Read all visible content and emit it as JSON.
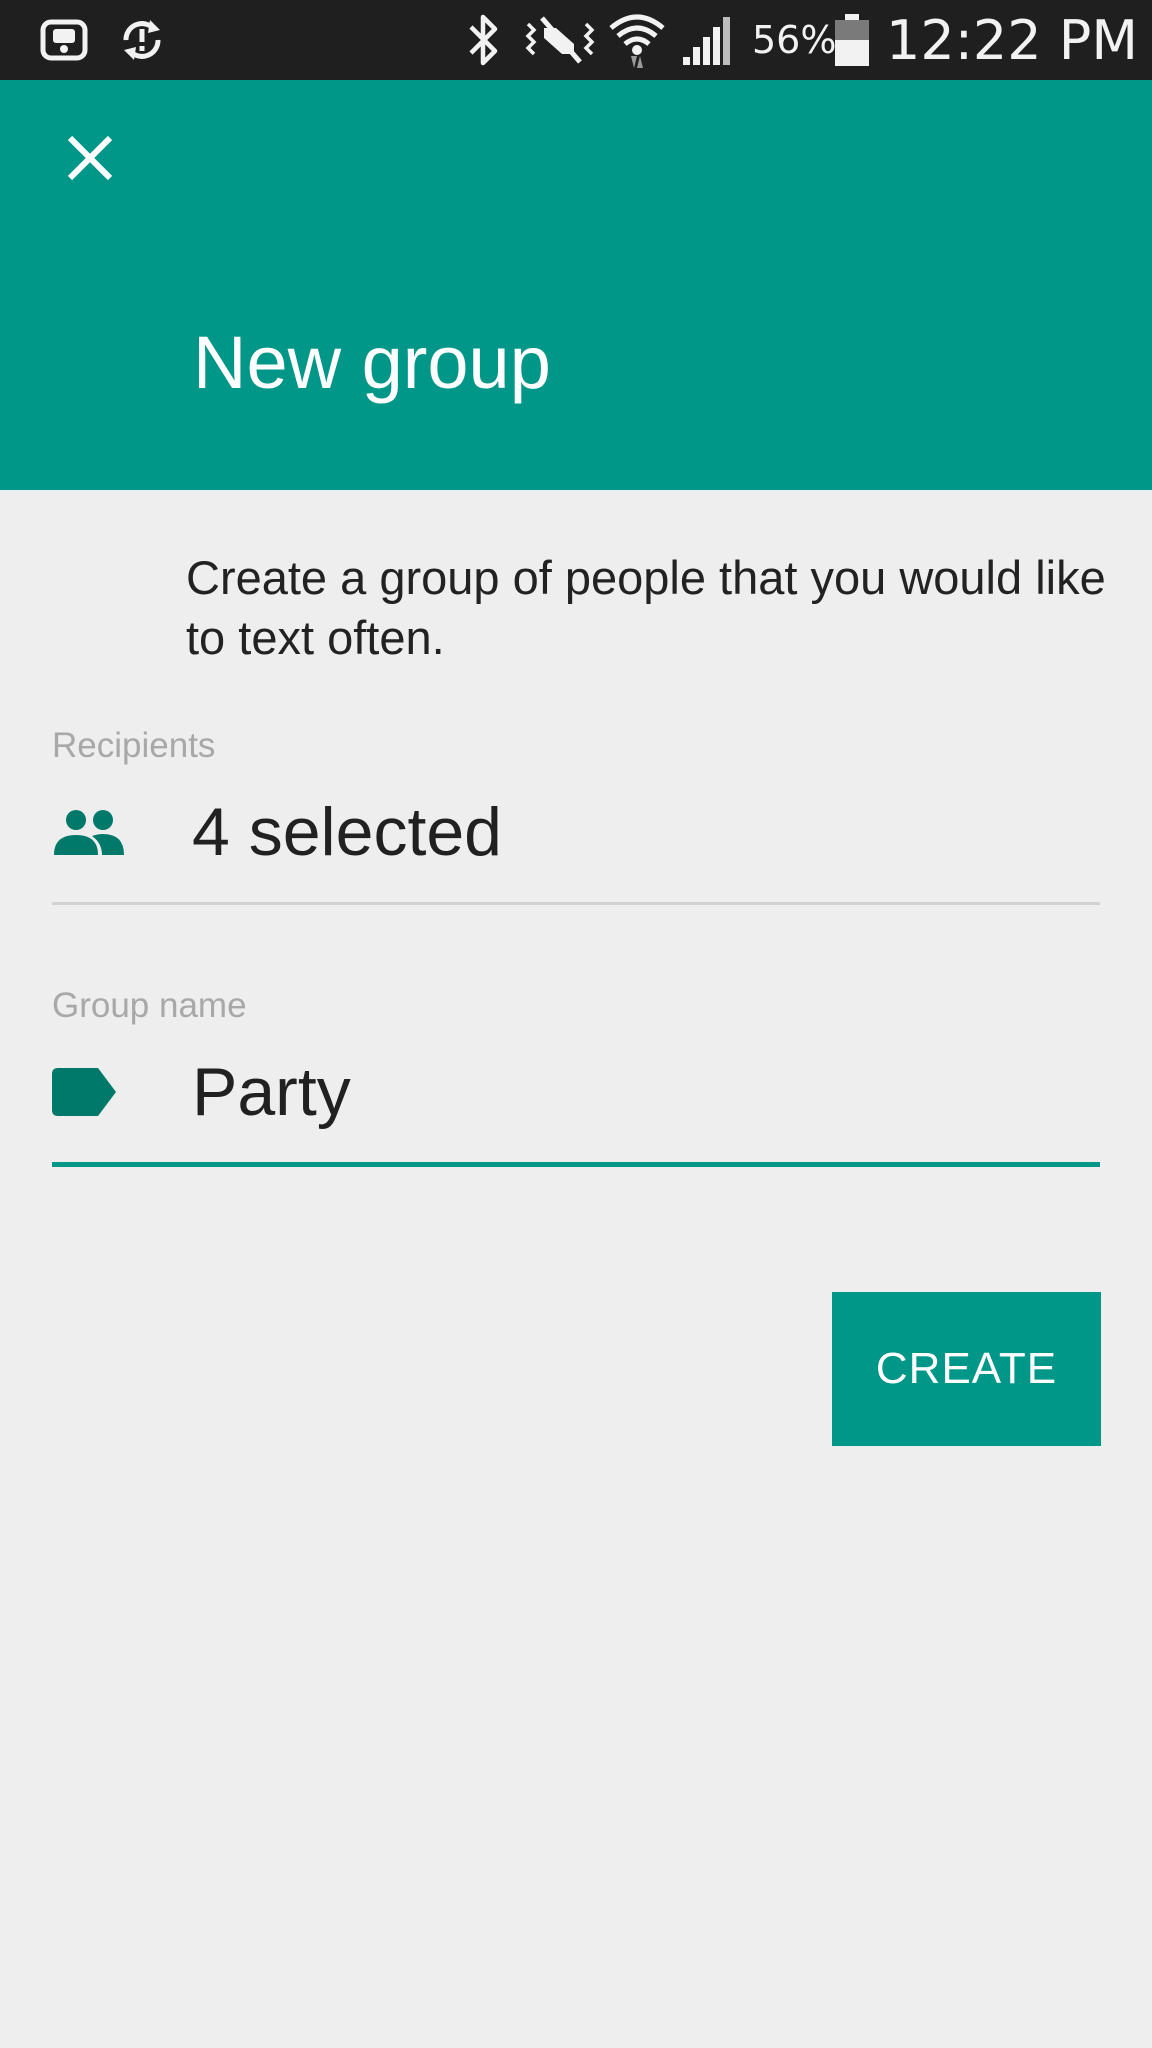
{
  "status_bar": {
    "battery_percent": "56%",
    "time": "12:22 PM",
    "battery_level": 0.56,
    "icons": [
      "screenshot-icon",
      "sync-alert-icon",
      "bluetooth-icon",
      "vibrate-icon",
      "wifi-icon",
      "cellular-signal-icon",
      "battery-icon"
    ]
  },
  "header": {
    "title": "New group",
    "close_icon": "close-icon"
  },
  "description": "Create a group of people that you would like to text often.",
  "recipients": {
    "label": "Recipients",
    "value": "4 selected",
    "icon": "people-icon"
  },
  "group_name": {
    "label": "Group name",
    "value": "Party",
    "icon": "label-tag-icon"
  },
  "create_button": {
    "label": "CREATE"
  },
  "colors": {
    "accent": "#009688",
    "status_bar": "#1f1f1f",
    "background": "#eeeeee",
    "icon_dark_teal": "#00796b",
    "divider": "#d2d2d2",
    "label": "#a8a8a8"
  }
}
